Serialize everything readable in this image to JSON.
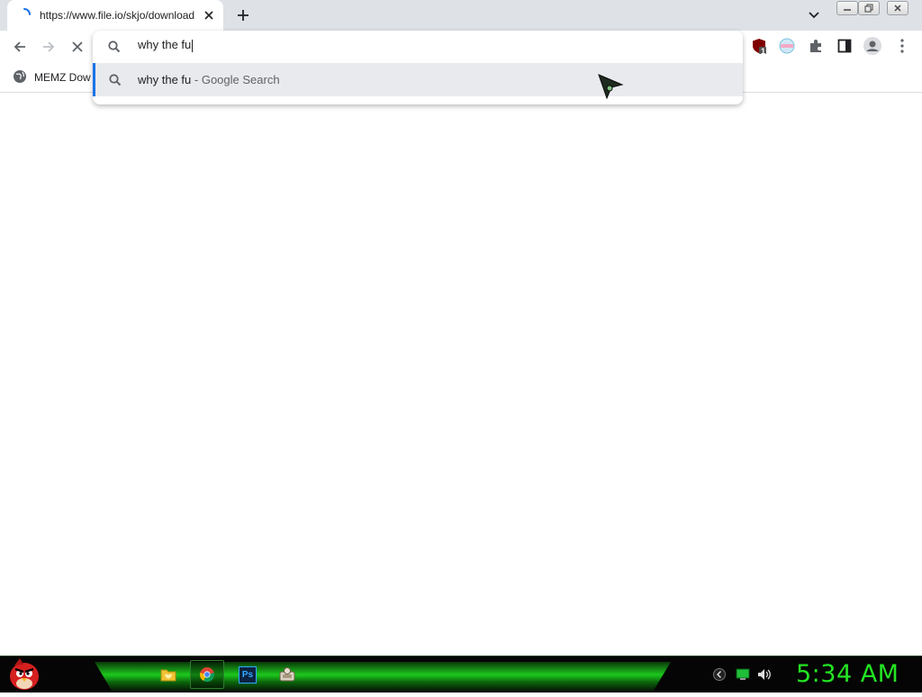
{
  "tab": {
    "title": "https://www.file.io/skjo/download",
    "loading": true
  },
  "omnibox": {
    "query": "why the fu",
    "suggestion": {
      "text": "why the fu",
      "separator": " - ",
      "source": "Google Search"
    }
  },
  "extensions": {
    "badge_count": "1"
  },
  "bookmarks": [
    {
      "label": "MEMZ Dow"
    }
  ],
  "taskbar": {
    "clock": "5:34 AM",
    "apps": [
      "folder-icon",
      "chrome-icon",
      "photoshop-icon",
      "app-icon"
    ],
    "photoshop_label": "Ps"
  },
  "colors": {
    "accent": "#1a73e8",
    "taskbar_green": "#23e523",
    "tabstrip": "#dee1e6"
  }
}
